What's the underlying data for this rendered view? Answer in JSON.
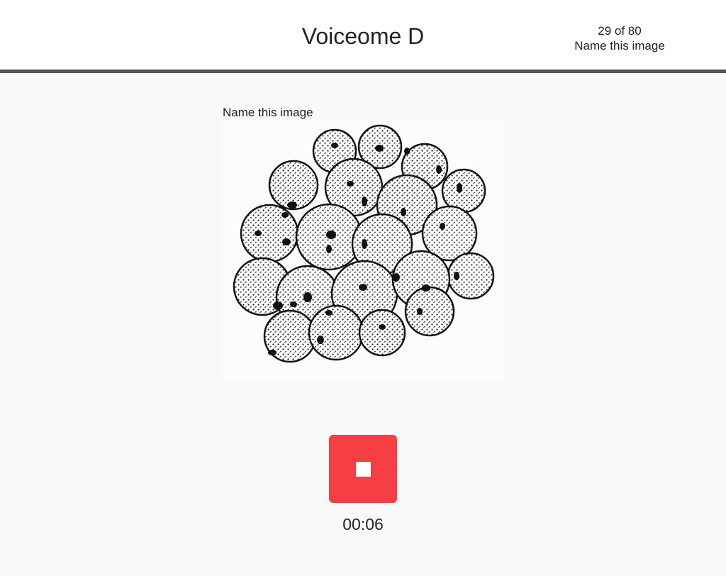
{
  "header": {
    "title": "Voiceome D",
    "progress": "29 of 80",
    "task_name": "Name this image"
  },
  "task": {
    "prompt": "Name this image",
    "image_icon": "coral-sketch-icon"
  },
  "recorder": {
    "button_icon": "stop-icon",
    "button_color": "#f53f43",
    "elapsed": "00:06"
  }
}
